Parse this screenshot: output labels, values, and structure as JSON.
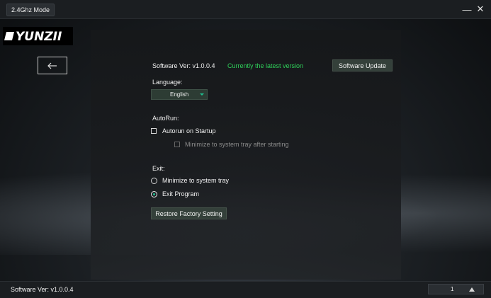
{
  "titlebar": {
    "mode_tab": "2.4Ghz Mode",
    "minimize_glyph": "—",
    "close_glyph": "✕"
  },
  "brand": {
    "logo_text": "YUNZII"
  },
  "navigation": {
    "back_icon": "arrow-left-icon"
  },
  "settings": {
    "software_version_label": "Software Ver: v1.0.0.4",
    "version_status": "Currently the latest version",
    "update_button": "Software Update",
    "language_label": "Language:",
    "language_value": "English",
    "autorun_label": "AutoRun:",
    "autorun_option": "Autorun on Startup",
    "autorun_checked": false,
    "minimize_tray_option": "Minimize to system tray after starting",
    "minimize_tray_enabled": false,
    "exit_label": "Exit:",
    "exit_options": [
      {
        "label": "Minimize to system tray",
        "selected": false
      },
      {
        "label": "Exit Program",
        "selected": true
      }
    ],
    "restore_button": "Restore Factory Setting"
  },
  "statusbar": {
    "version_text": "Software Ver: v1.0.0.4",
    "page_number": "1"
  },
  "colors": {
    "accent": "#1fbf8f",
    "status_green": "#2fd05a",
    "button_bg": "#34403a"
  }
}
